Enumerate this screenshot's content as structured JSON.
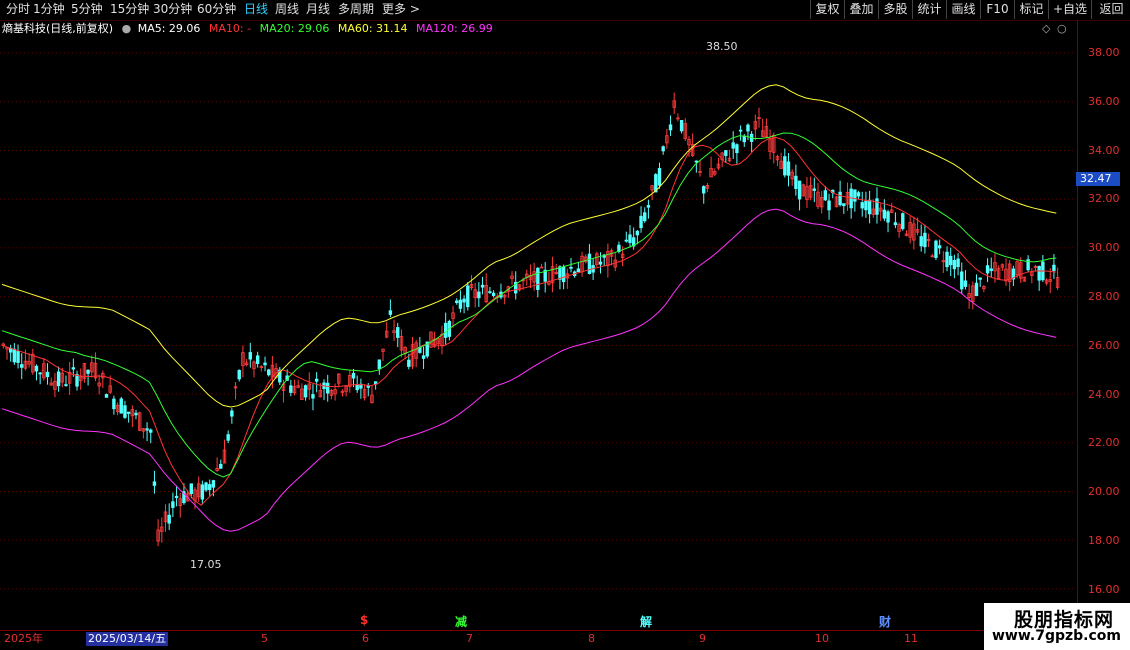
{
  "toolbar": {
    "periods": [
      "分时",
      "1分钟",
      "5分钟",
      "15分钟",
      "30分钟",
      "60分钟",
      "日线",
      "周线",
      "月线",
      "多周期",
      "更多 >"
    ],
    "active_period": "日线",
    "buttons": [
      "复权",
      "叠加",
      "多股",
      "统计",
      "画线",
      "F10",
      "标记",
      "+自选",
      "返回"
    ]
  },
  "stock": {
    "name": "熵基科技(日线,前复权)"
  },
  "indicators": {
    "ma5": "MA5: 29.06",
    "ma10": "MA10: -",
    "ma20": "MA20: 29.06",
    "ma60": "MA60: 31.14",
    "ma120": "MA120: 26.99"
  },
  "colors": {
    "up": "#ff3c3c",
    "down": "#54ffff",
    "ma5": "#ffffff",
    "ma10": "#ff3333",
    "ma20": "#33ff33",
    "ma60": "#ffff33",
    "ma120": "#ff33ff"
  },
  "price_axis": [
    "38.00",
    "36.00",
    "34.00",
    "32.00",
    "30.00",
    "28.00",
    "26.00",
    "24.00",
    "22.00",
    "20.00",
    "18.00",
    "16.00"
  ],
  "current_price": "32.47",
  "high_marker": "38.50",
  "low_marker": "17.05",
  "date_axis": {
    "year": "2025年",
    "selected_date": "2025/03/14/五",
    "months": [
      "5",
      "6",
      "7",
      "8",
      "9",
      "10",
      "11"
    ]
  },
  "events": [
    "$",
    "减",
    "解",
    "财"
  ],
  "watermark": {
    "title": "股朋指标网",
    "url": "www.7gpzb.com"
  }
}
